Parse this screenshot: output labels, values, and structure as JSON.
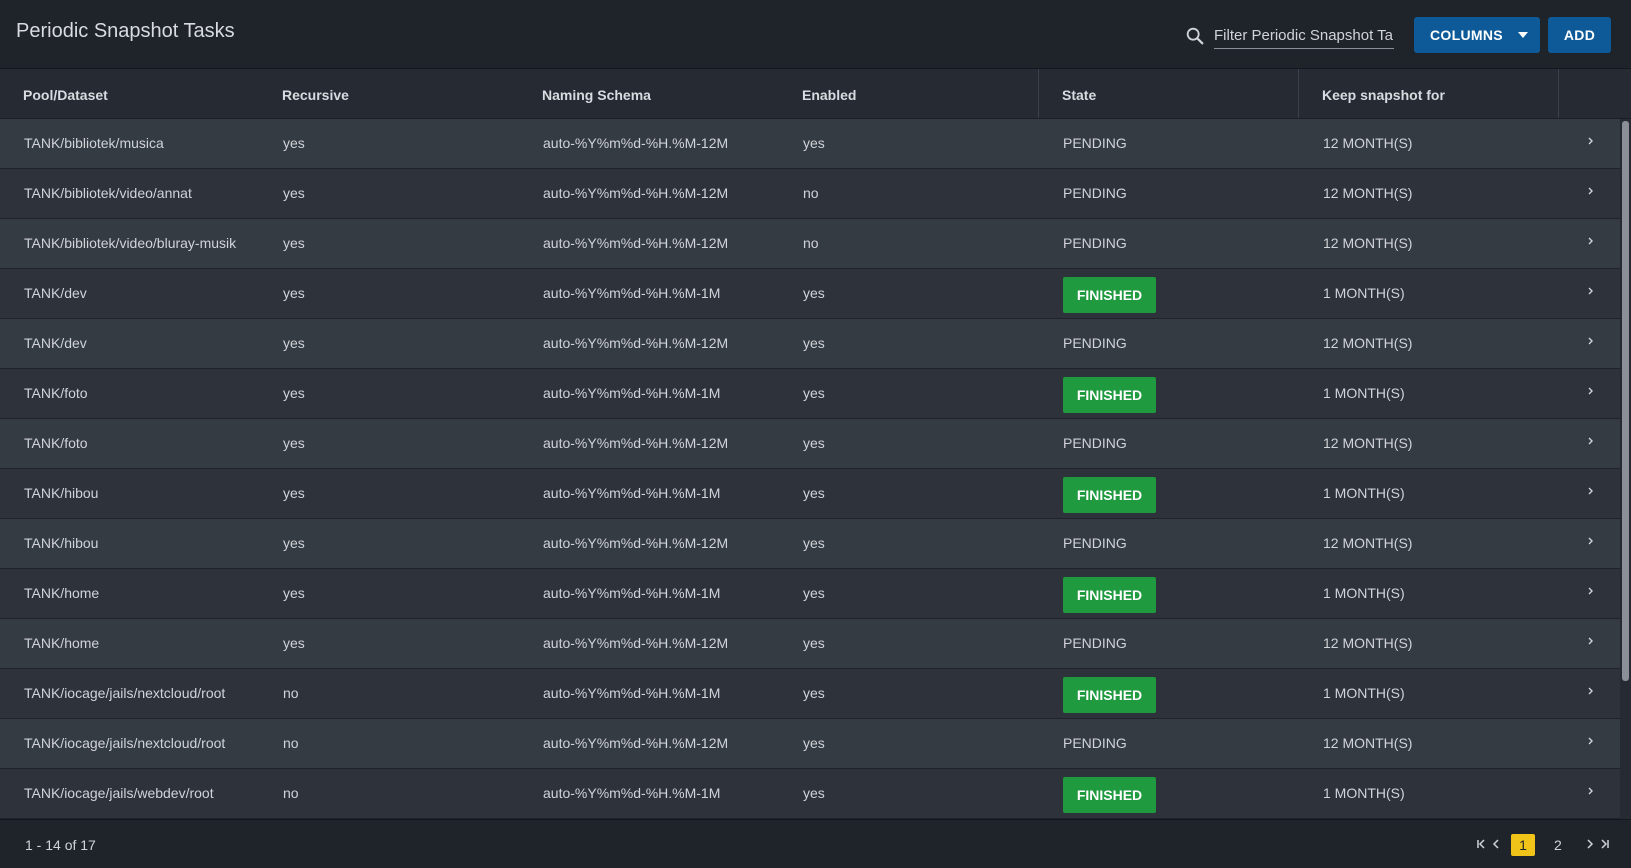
{
  "header": {
    "title": "Periodic Snapshot Tasks",
    "search_placeholder": "Filter Periodic Snapshot Ta...",
    "columns_label": "COLUMNS",
    "add_label": "ADD"
  },
  "table": {
    "columns": [
      "Pool/Dataset",
      "Recursive",
      "Naming Schema",
      "Enabled",
      "State",
      "Keep snapshot for"
    ],
    "rows": [
      {
        "dataset": "TANK/bibliotek/musica",
        "recursive": "yes",
        "schema": "auto-%Y%m%d-%H.%M-12M",
        "enabled": "yes",
        "state": "PENDING",
        "keep": "12 MONTH(S)"
      },
      {
        "dataset": "TANK/bibliotek/video/annat",
        "recursive": "yes",
        "schema": "auto-%Y%m%d-%H.%M-12M",
        "enabled": "no",
        "state": "PENDING",
        "keep": "12 MONTH(S)"
      },
      {
        "dataset": "TANK/bibliotek/video/bluray-musik",
        "recursive": "yes",
        "schema": "auto-%Y%m%d-%H.%M-12M",
        "enabled": "no",
        "state": "PENDING",
        "keep": "12 MONTH(S)"
      },
      {
        "dataset": "TANK/dev",
        "recursive": "yes",
        "schema": "auto-%Y%m%d-%H.%M-1M",
        "enabled": "yes",
        "state": "FINISHED",
        "keep": "1 MONTH(S)"
      },
      {
        "dataset": "TANK/dev",
        "recursive": "yes",
        "schema": "auto-%Y%m%d-%H.%M-12M",
        "enabled": "yes",
        "state": "PENDING",
        "keep": "12 MONTH(S)"
      },
      {
        "dataset": "TANK/foto",
        "recursive": "yes",
        "schema": "auto-%Y%m%d-%H.%M-1M",
        "enabled": "yes",
        "state": "FINISHED",
        "keep": "1 MONTH(S)"
      },
      {
        "dataset": "TANK/foto",
        "recursive": "yes",
        "schema": "auto-%Y%m%d-%H.%M-12M",
        "enabled": "yes",
        "state": "PENDING",
        "keep": "12 MONTH(S)"
      },
      {
        "dataset": "TANK/hibou",
        "recursive": "yes",
        "schema": "auto-%Y%m%d-%H.%M-1M",
        "enabled": "yes",
        "state": "FINISHED",
        "keep": "1 MONTH(S)"
      },
      {
        "dataset": "TANK/hibou",
        "recursive": "yes",
        "schema": "auto-%Y%m%d-%H.%M-12M",
        "enabled": "yes",
        "state": "PENDING",
        "keep": "12 MONTH(S)"
      },
      {
        "dataset": "TANK/home",
        "recursive": "yes",
        "schema": "auto-%Y%m%d-%H.%M-1M",
        "enabled": "yes",
        "state": "FINISHED",
        "keep": "1 MONTH(S)"
      },
      {
        "dataset": "TANK/home",
        "recursive": "yes",
        "schema": "auto-%Y%m%d-%H.%M-12M",
        "enabled": "yes",
        "state": "PENDING",
        "keep": "12 MONTH(S)"
      },
      {
        "dataset": "TANK/iocage/jails/nextcloud/root",
        "recursive": "no",
        "schema": "auto-%Y%m%d-%H.%M-1M",
        "enabled": "yes",
        "state": "FINISHED",
        "keep": "1 MONTH(S)"
      },
      {
        "dataset": "TANK/iocage/jails/nextcloud/root",
        "recursive": "no",
        "schema": "auto-%Y%m%d-%H.%M-12M",
        "enabled": "yes",
        "state": "PENDING",
        "keep": "12 MONTH(S)"
      },
      {
        "dataset": "TANK/iocage/jails/webdev/root",
        "recursive": "no",
        "schema": "auto-%Y%m%d-%H.%M-1M",
        "enabled": "yes",
        "state": "FINISHED",
        "keep": "1 MONTH(S)"
      }
    ]
  },
  "footer": {
    "range": "1 - 14 of 17",
    "current_page": "1",
    "next_page": "2"
  },
  "colors": {
    "accent": "#0e5a98",
    "finished": "#1f9a3f",
    "page_highlight": "#f0c419"
  }
}
